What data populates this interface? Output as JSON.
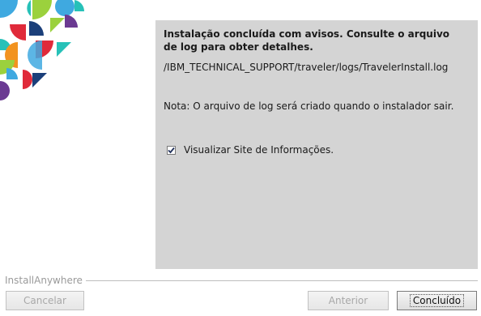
{
  "panel": {
    "heading": "Instalação concluída com avisos.  Consulte o arquivo de log para obter detalhes.",
    "log_path": "/IBM_TECHNICAL_SUPPORT/traveler/logs/TravelerInstall.log",
    "note": "Nota: O arquivo de log será criado quando o instalador sair.",
    "checkbox": {
      "label": "Visualizar Site de Informações.",
      "checked": true
    }
  },
  "footer": {
    "brand": "InstallAnywhere"
  },
  "buttons": {
    "cancel": "Cancelar",
    "back": "Anterior",
    "done": "Concluído"
  },
  "colors": {
    "panel_bg": "#d4d4d4",
    "art_blue": "#3fa9e0",
    "art_teal": "#27c1b8",
    "art_purple": "#6b3a92",
    "art_green": "#9bd13d",
    "art_red": "#e02a3a",
    "art_orange": "#f29320",
    "art_navy": "#1b3f7a"
  }
}
